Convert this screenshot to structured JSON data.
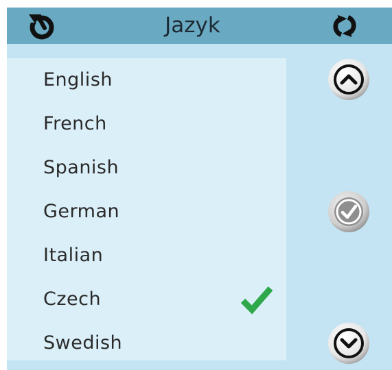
{
  "header": {
    "title": "Jazyk",
    "back_icon": "back-arrow-icon",
    "refresh_icon": "refresh-icon"
  },
  "languages": [
    {
      "label": "English",
      "selected": false
    },
    {
      "label": "French",
      "selected": false
    },
    {
      "label": "Spanish",
      "selected": false
    },
    {
      "label": "German",
      "selected": false
    },
    {
      "label": "Italian",
      "selected": false
    },
    {
      "label": "Czech",
      "selected": true
    },
    {
      "label": "Swedish",
      "selected": false
    }
  ],
  "sidebar": {
    "up_icon": "chevron-up-icon",
    "confirm_icon": "checkmark-icon",
    "down_icon": "chevron-down-icon"
  },
  "colors": {
    "header_bg": "#6aa9c2",
    "screen_bg": "#c4e4f4",
    "list_bg": "#dbeff9",
    "check": "#2ea84a"
  }
}
